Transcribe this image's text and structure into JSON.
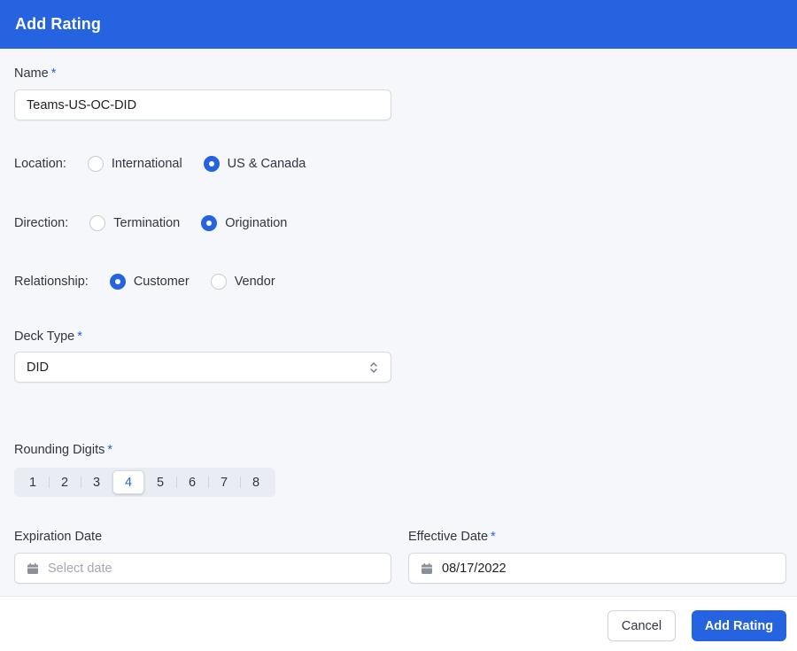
{
  "dialog": {
    "title": "Add Rating"
  },
  "name": {
    "label": "Name",
    "required_mark": "*",
    "value": "Teams-US-OC-DID"
  },
  "location": {
    "label": "Location:",
    "options": [
      {
        "label": "International",
        "checked": false
      },
      {
        "label": "US & Canada",
        "checked": true
      }
    ]
  },
  "direction": {
    "label": "Direction:",
    "options": [
      {
        "label": "Termination",
        "checked": false
      },
      {
        "label": "Origination",
        "checked": true
      }
    ]
  },
  "relationship": {
    "label": "Relationship:",
    "options": [
      {
        "label": "Customer",
        "checked": true
      },
      {
        "label": "Vendor",
        "checked": false
      }
    ]
  },
  "deck_type": {
    "label": "Deck Type",
    "required_mark": "*",
    "value": "DID"
  },
  "rounding": {
    "label": "Rounding Digits",
    "required_mark": "*",
    "options": [
      "1",
      "2",
      "3",
      "4",
      "5",
      "6",
      "7",
      "8"
    ],
    "selected": "4"
  },
  "expiration": {
    "label": "Expiration Date",
    "placeholder": "Select date",
    "value": ""
  },
  "effective": {
    "label": "Effective Date",
    "required_mark": "*",
    "value": "08/17/2022"
  },
  "footer": {
    "cancel_label": "Cancel",
    "submit_label": "Add Rating"
  },
  "colors": {
    "accent": "#2563e0",
    "background": "#f6f7fa"
  },
  "icons": {
    "select": "chevron-up-down-icon",
    "date": "calendar-icon"
  }
}
